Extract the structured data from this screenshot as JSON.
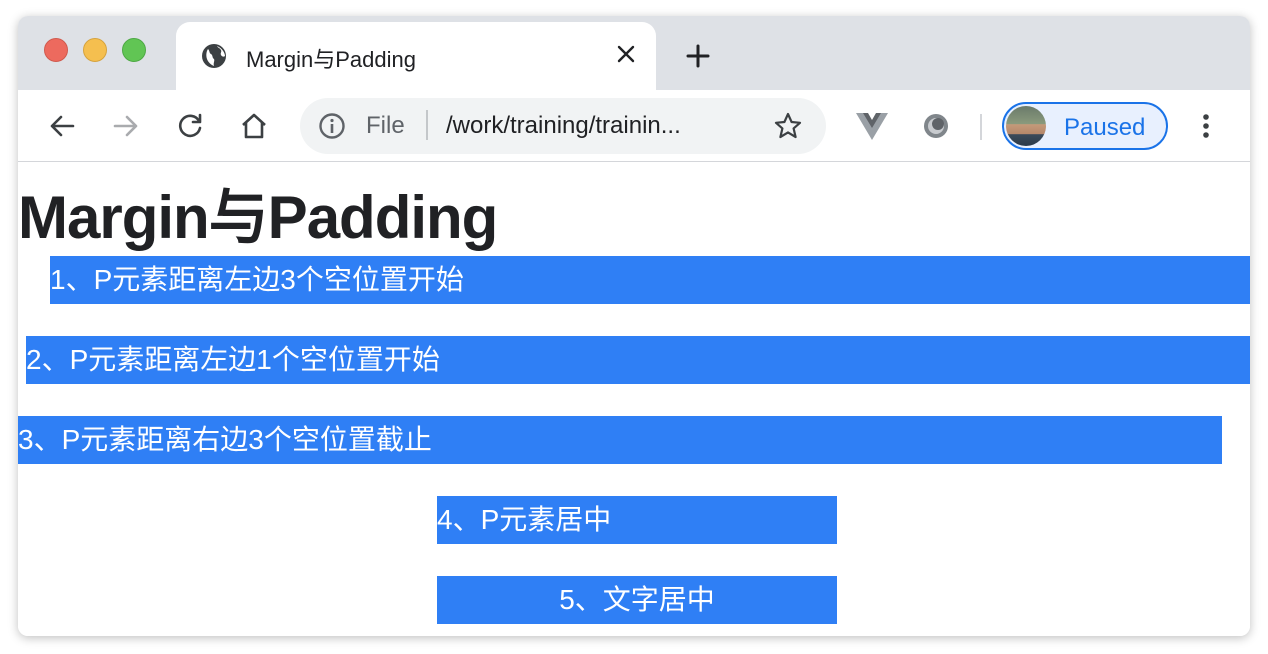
{
  "tab": {
    "title": "Margin与Padding",
    "favicon": "globe-icon",
    "close": "close-icon"
  },
  "new_tab": "plus-icon",
  "toolbar": {
    "back": "back-arrow-icon",
    "forward": "forward-arrow-icon",
    "reload": "reload-icon",
    "home": "home-icon",
    "omnibox": {
      "info": "info-icon",
      "scheme": "File",
      "url": "/work/training/trainin...",
      "bookmark": "star-icon"
    },
    "extensions": [
      "vue-devtools-icon",
      "extension-ring-icon"
    ],
    "profile": {
      "label": "Paused",
      "avatar": "avatar"
    },
    "menu": "kebab-menu-icon"
  },
  "page": {
    "heading": "Margin与Padding",
    "paragraphs": [
      "1、P元素距离左边3个空位置开始",
      "2、P元素距离左边1个空位置开始",
      "3、P元素距离右边3个空位置截止",
      "4、P元素居中",
      "5、文字居中"
    ]
  },
  "colors": {
    "bar_blue": "#2f7ff5",
    "titlebar": "#dee1e6",
    "profile_accent": "#1a73e8"
  }
}
